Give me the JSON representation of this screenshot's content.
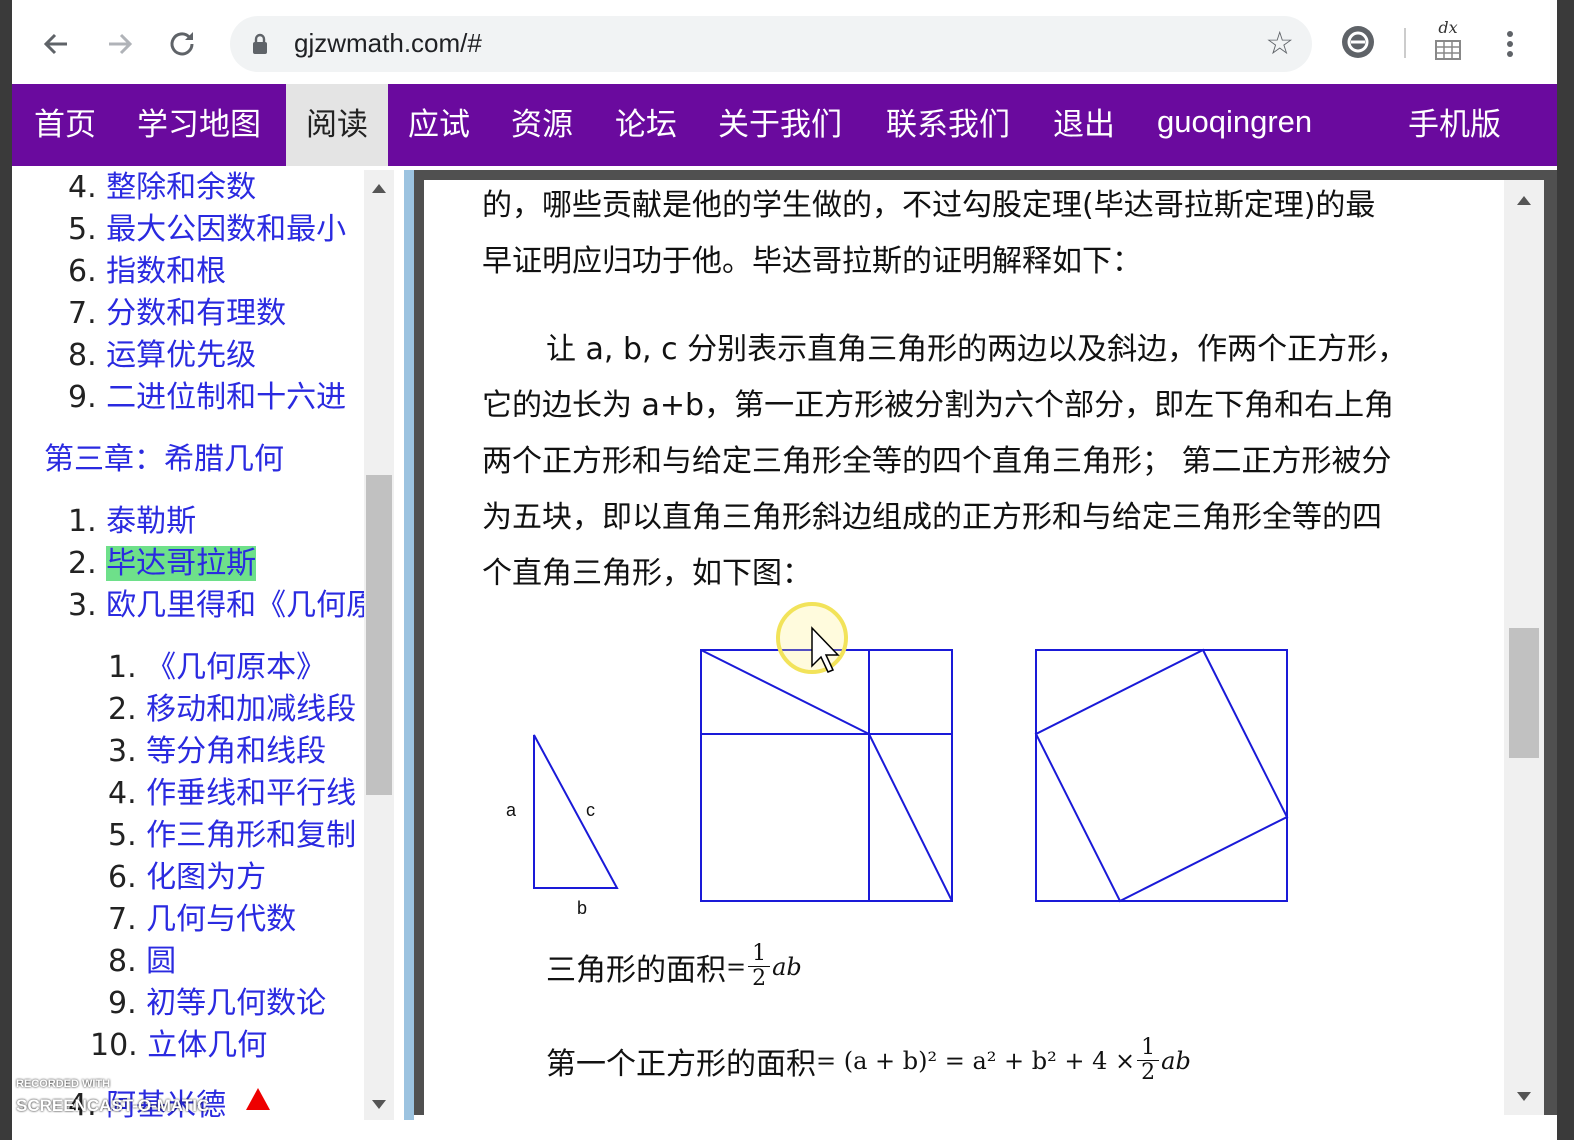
{
  "browser": {
    "url": "gjzwmath.com/#",
    "ext_label": "dx"
  },
  "nav": {
    "items": [
      "首页",
      "学习地图",
      "阅读",
      "应试",
      "资源",
      "论坛",
      "关于我们",
      "联系我们",
      "退出",
      "guoqingren",
      "手机版"
    ],
    "active": "阅读"
  },
  "sidebar": {
    "items": [
      {
        "num": "4.",
        "label": "整除和余数"
      },
      {
        "num": "5.",
        "label": "最大公因数和最小"
      },
      {
        "num": "6.",
        "label": "指数和根"
      },
      {
        "num": "7.",
        "label": "分数和有理数"
      },
      {
        "num": "8.",
        "label": "运算优先级"
      },
      {
        "num": "9.",
        "label": "二进位制和十六进"
      }
    ],
    "chapter": "第三章：希腊几何",
    "chapter_items": [
      {
        "num": "1.",
        "label": "泰勒斯"
      },
      {
        "num": "2.",
        "label": "毕达哥拉斯"
      },
      {
        "num": "3.",
        "label": "欧几里得和《几何原"
      }
    ],
    "sub_items": [
      {
        "num": "1.",
        "label": "《几何原本》"
      },
      {
        "num": "2.",
        "label": "移动和加减线段"
      },
      {
        "num": "3.",
        "label": "等分角和线段"
      },
      {
        "num": "4.",
        "label": "作垂线和平行线"
      },
      {
        "num": "5.",
        "label": "作三角形和复制"
      },
      {
        "num": "6.",
        "label": "化图为方"
      },
      {
        "num": "7.",
        "label": "几何与代数"
      },
      {
        "num": "8.",
        "label": "圆"
      },
      {
        "num": "9.",
        "label": "初等几何数论"
      },
      {
        "num": "10.",
        "label": "立体几何"
      }
    ],
    "last_item": {
      "num": "4.",
      "label": "阿基米德"
    },
    "watermark_top": "RECORDED WITH",
    "watermark_bottom": "SCREENCAST-O-MATIC"
  },
  "content": {
    "lines": [
      "的，哪些贡献是他的学生做的，不过勾股定理(毕达哥拉斯定理)的最",
      "早证明应归功于他。毕达哥拉斯的证明解释如下：",
      "让 a, b, c 分别表示直角三角形的两边以及斜边，作两个正方形，",
      "它的边长为 a+b，第一正方形被分割为六个部分，即左下角和右上角",
      "两个正方形和与给定三角形全等的四个直角三角形； 第二正方形被分",
      "为五块，即以直角三角形斜边组成的正方形和与给定三角形全等的四",
      "个直角三角形，如下图："
    ],
    "triangle_labels": {
      "a": "a",
      "b": "b",
      "c": "c"
    },
    "formula1": {
      "label": "三角形的面积",
      "eq": "=",
      "num": "1",
      "den": "2",
      "rest": "ab"
    },
    "formula2": {
      "label": "第一个正方形的面积",
      "lhs": "= (a + b)² = a² + b² + 4 × ",
      "num": "1",
      "den": "2",
      "rest": "ab"
    }
  },
  "colors": {
    "nav_bg": "#6a0a9e",
    "link": "#2a2ae0",
    "highlight": "#6ee08a",
    "figure_stroke": "#1a1ad8"
  }
}
